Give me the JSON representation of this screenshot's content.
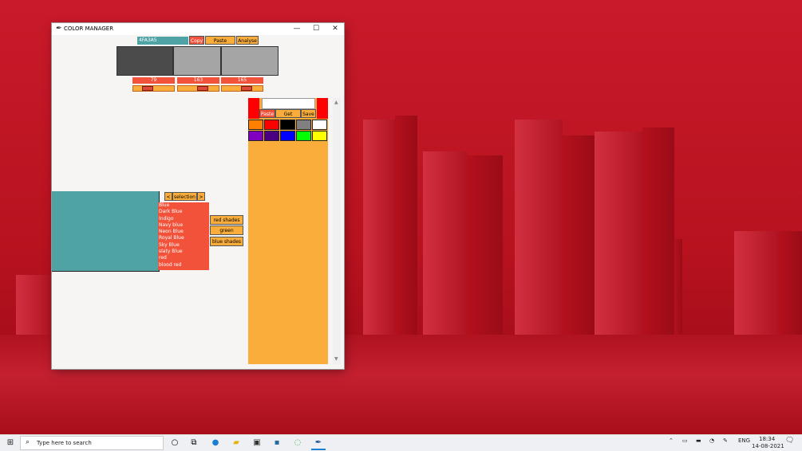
{
  "window": {
    "title": "COLOR MANAGER",
    "controls": {
      "minimize": "—",
      "maximize": "☐",
      "close": "✕"
    }
  },
  "toolbar": {
    "hex_value": "4FA3A5",
    "copy_label": "Copy",
    "paste_image_label": "Paste Image",
    "analyse_label": "Analyse"
  },
  "swatches": [
    {
      "name": "dark",
      "color": "#4b4b4b"
    },
    {
      "name": "mid",
      "color": "#a5a5a5"
    },
    {
      "name": "light",
      "color": "#a5a5a5"
    }
  ],
  "sliders": [
    {
      "label": "79",
      "value": 79,
      "max": 255
    },
    {
      "label": "163",
      "value": 163,
      "max": 255
    },
    {
      "label": "165",
      "value": 165,
      "max": 255
    }
  ],
  "preview_color": "#4fa3a5",
  "selection_nav": {
    "prev": "<",
    "label": "selection",
    "next": ">"
  },
  "color_list": [
    "Blue",
    "Dark Blue",
    "Indigo",
    "Navy blue",
    "Neon Blue",
    "Royal Blue",
    "Sky Blue",
    "slaty Blue",
    "red",
    "blood red"
  ],
  "shade_buttons": {
    "red": "red shades",
    "green": "green shades",
    "blue": "blue shades"
  },
  "palette": {
    "paste_label": "Paste",
    "get_colors_label": "Get colors",
    "save_label": "Save",
    "input_value": "",
    "grid": [
      [
        "#ff8000",
        "#ff0000",
        "#000000",
        "#808080",
        "#ffffff"
      ],
      [
        "#8000c0",
        "#4b0082",
        "#0000ff",
        "#00ff00",
        "#ffff00"
      ]
    ]
  },
  "taskbar": {
    "search_placeholder": "Type here to search",
    "language": "ENG",
    "time": "18:34",
    "date": "14-08-2021"
  }
}
